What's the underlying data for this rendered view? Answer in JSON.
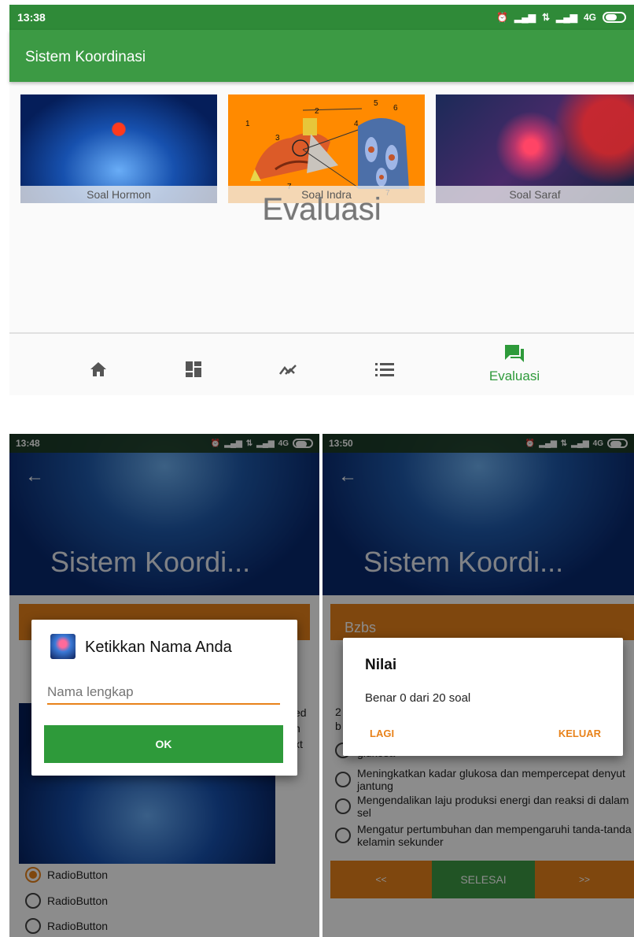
{
  "top": {
    "status_time": "13:38",
    "network": "4G",
    "app_title": "Sistem Koordinasi",
    "cards": [
      {
        "label": "Soal Hormon"
      },
      {
        "label": "Soal Indra"
      },
      {
        "label": "Soal Saraf"
      }
    ],
    "indra_numbers": [
      "1",
      "2",
      "3",
      "4",
      "5",
      "6",
      "7",
      "7"
    ],
    "page_watermark": "Evaluasi",
    "nav": {
      "active_label": "Evaluasi",
      "active_color": "#2e9a3a",
      "icons": [
        "home-icon",
        "dashboard-icon",
        "trending-icon",
        "list-icon",
        "forum-icon"
      ]
    }
  },
  "left": {
    "status_time": "13:48",
    "network": "4G",
    "header_title": "Sistem Koordi...",
    "partial_text": [
      "ed",
      "n",
      "xt"
    ],
    "radio_options": [
      "RadioButton",
      "RadioButton",
      "RadioButton"
    ],
    "dialog": {
      "title": "Ketikkan Nama Anda",
      "placeholder": "Nama lengkap",
      "ok_label": "OK"
    }
  },
  "right": {
    "status_time": "13:50",
    "network": "4G",
    "header_title": "Sistem Koordi...",
    "name_bar": "Bzbs",
    "question_prefix": [
      "2",
      "b"
    ],
    "options": [
      "glukosa",
      "Meningkatkan kadar glukosa dan mempercepat denyut jantung",
      "Mengendalikan laju produksi energi dan reaksi di dalam sel",
      "Mengatur pertumbuhan dan mempengaruhi tanda-tanda kelamin sekunder"
    ],
    "buttons": {
      "prev": "<<",
      "finish": "SELESAI",
      "next": ">>"
    },
    "dialog": {
      "title": "Nilai",
      "message": "Benar 0 dari 20 soal",
      "again": "LAGI",
      "exit": "KELUAR"
    }
  },
  "colors": {
    "green": "#3c9a44",
    "dark_green": "#2f7f36",
    "orange": "#e8821a",
    "button_green": "#2e9a3a"
  }
}
